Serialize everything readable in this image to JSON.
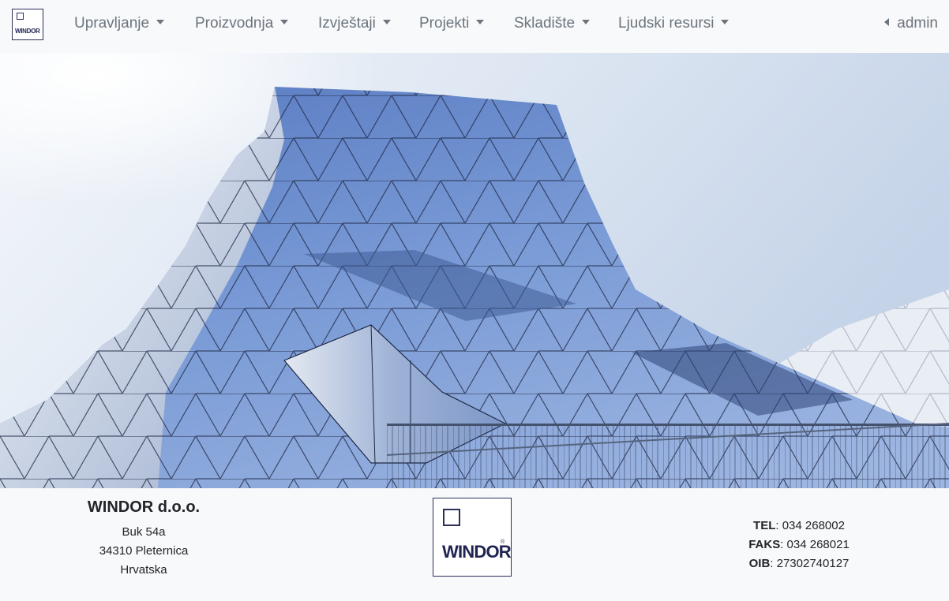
{
  "brand": {
    "logo_text": "WINDOR"
  },
  "nav": {
    "items": [
      {
        "label": "Upravljanje"
      },
      {
        "label": "Proizvodnja"
      },
      {
        "label": "Izvještaji"
      },
      {
        "label": "Projekti"
      },
      {
        "label": "Skladište"
      },
      {
        "label": "Ljudski resursi"
      }
    ],
    "user": "admin"
  },
  "footer": {
    "company_name": "WINDOR d.o.o.",
    "address": [
      "Buk 54a",
      "34310 Pleternica",
      "Hrvatska"
    ],
    "logo_text": "WINDOR",
    "logo_mark": "®",
    "contact": [
      {
        "key": "TEL",
        "value": ": 034 268002"
      },
      {
        "key": "FAKS",
        "value": ": 034 268021"
      },
      {
        "key": "OIB",
        "value": ": 27302740127"
      }
    ]
  },
  "colors": {
    "navbar_bg": "#f8f9fa",
    "nav_text": "#6c757d",
    "brand": "#2b2f5a"
  },
  "icons": {
    "dropdown": "caret-down-icon",
    "user_menu": "caret-left-icon"
  }
}
